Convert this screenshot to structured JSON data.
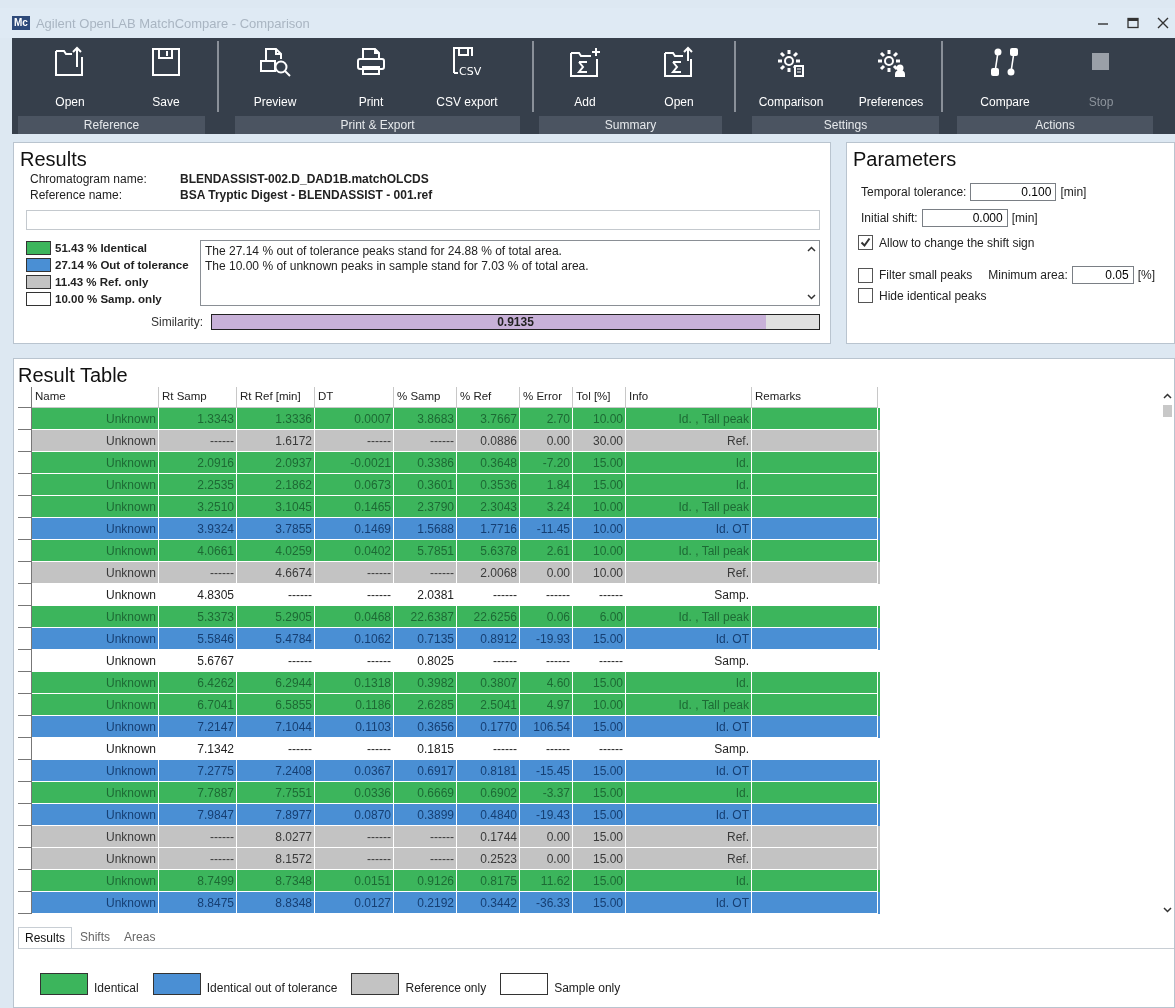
{
  "window": {
    "app_icon": "Mc",
    "title": "Agilent OpenLAB MatchCompare - Comparison"
  },
  "toolbar": {
    "groups": [
      {
        "label": "Reference",
        "buttons": [
          {
            "label": "Open",
            "disabled": false
          },
          {
            "label": "Save",
            "disabled": false
          }
        ]
      },
      {
        "label": "Print & Export",
        "buttons": [
          {
            "label": "Preview",
            "disabled": false
          },
          {
            "label": "Print",
            "disabled": false
          },
          {
            "label": "CSV export",
            "disabled": false,
            "icon_text": "CSV"
          }
        ]
      },
      {
        "label": "Summary",
        "buttons": [
          {
            "label": "Add",
            "disabled": false
          },
          {
            "label": "Open",
            "disabled": false
          }
        ]
      },
      {
        "label": "Settings",
        "buttons": [
          {
            "label": "Comparison",
            "disabled": false
          },
          {
            "label": "Preferences",
            "disabled": false
          }
        ]
      },
      {
        "label": "Actions",
        "buttons": [
          {
            "label": "Compare",
            "disabled": false
          },
          {
            "label": "Stop",
            "disabled": true
          }
        ]
      }
    ]
  },
  "results": {
    "title": "Results",
    "fields": [
      {
        "label": "Chromatogram name:",
        "value": "BLENDASSIST-002.D_DAD1B.matchOLCDS"
      },
      {
        "label": "Reference name:",
        "value": "BSA Tryptic Digest - BLENDASSIST - 001.ref"
      }
    ],
    "summary_legend": [
      {
        "label": "51.43 % Identical",
        "color": "#3cb55c"
      },
      {
        "label": "27.14 % Out of tolerance",
        "color": "#4a8fd4"
      },
      {
        "label": "11.43 % Ref. only",
        "color": "#c3c3c3"
      },
      {
        "label": "10.00 % Samp. only",
        "color": "#ffffff"
      }
    ],
    "messages": [
      "The 27.14 % out of tolerance peaks stand for 24.88 % of total area.",
      "The 10.00 % of unknown peaks in sample stand for 7.03 % of total area."
    ],
    "similarity": {
      "label": "Similarity:",
      "level": 0.9135,
      "reading": "0.9135"
    }
  },
  "parameters": {
    "title": "Parameters",
    "temporal_tolerance": {
      "label": "Temporal tolerance:",
      "value": "0.100",
      "unit": "[min]"
    },
    "initial_shift": {
      "label": "Initial shift:",
      "value": "0.000",
      "unit": "[min]"
    },
    "allow_shift_sign": {
      "label": "Allow to change the shift sign",
      "checked": true
    },
    "filter_small_peaks": {
      "label": "Filter small peaks",
      "checked": false
    },
    "minimum_area": {
      "label": "Minimum area:",
      "value": "0.05",
      "unit": "[%]"
    },
    "hide_identical": {
      "label": "Hide identical peaks",
      "checked": false
    }
  },
  "result_table": {
    "title": "Result Table",
    "columns": [
      "Name",
      "Rt Samp",
      "Rt Ref [min]",
      "DT",
      "% Samp",
      "% Ref",
      "% Error",
      "Tol [%]",
      "Info",
      "Remarks"
    ],
    "rows": [
      {
        "kind": "identical",
        "cells": [
          "Unknown",
          "1.3343",
          "1.3336",
          "0.0007",
          "3.8683",
          "3.7667",
          "2.70",
          "10.00",
          "Id. , Tall peak"
        ]
      },
      {
        "kind": "ref",
        "cells": [
          "Unknown",
          "------",
          "1.6172",
          "------",
          "------",
          "0.0886",
          "0.00",
          "30.00",
          "Ref."
        ]
      },
      {
        "kind": "identical",
        "cells": [
          "Unknown",
          "2.0916",
          "2.0937",
          "-0.0021",
          "0.3386",
          "0.3648",
          "-7.20",
          "15.00",
          "Id."
        ]
      },
      {
        "kind": "identical",
        "cells": [
          "Unknown",
          "2.2535",
          "2.1862",
          "0.0673",
          "0.3601",
          "0.3536",
          "1.84",
          "15.00",
          "Id."
        ]
      },
      {
        "kind": "identical",
        "cells": [
          "Unknown",
          "3.2510",
          "3.1045",
          "0.1465",
          "2.3790",
          "2.3043",
          "3.24",
          "10.00",
          "Id. , Tall peak"
        ]
      },
      {
        "kind": "ot",
        "cells": [
          "Unknown",
          "3.9324",
          "3.7855",
          "0.1469",
          "1.5688",
          "1.7716",
          "-11.45",
          "10.00",
          "Id. OT"
        ]
      },
      {
        "kind": "identical",
        "cells": [
          "Unknown",
          "4.0661",
          "4.0259",
          "0.0402",
          "5.7851",
          "5.6378",
          "2.61",
          "10.00",
          "Id. , Tall peak"
        ]
      },
      {
        "kind": "ref",
        "cells": [
          "Unknown",
          "------",
          "4.6674",
          "------",
          "------",
          "2.0068",
          "0.00",
          "10.00",
          "Ref."
        ]
      },
      {
        "kind": "samp",
        "cells": [
          "Unknown",
          "4.8305",
          "------",
          "------",
          "2.0381",
          "------",
          "------",
          "------",
          "Samp."
        ]
      },
      {
        "kind": "identical",
        "cells": [
          "Unknown",
          "5.3373",
          "5.2905",
          "0.0468",
          "22.6387",
          "22.6256",
          "0.06",
          "6.00",
          "Id. , Tall peak"
        ]
      },
      {
        "kind": "ot",
        "cells": [
          "Unknown",
          "5.5846",
          "5.4784",
          "0.1062",
          "0.7135",
          "0.8912",
          "-19.93",
          "15.00",
          "Id. OT"
        ]
      },
      {
        "kind": "samp",
        "cells": [
          "Unknown",
          "5.6767",
          "------",
          "------",
          "0.8025",
          "------",
          "------",
          "------",
          "Samp."
        ]
      },
      {
        "kind": "identical",
        "cells": [
          "Unknown",
          "6.4262",
          "6.2944",
          "0.1318",
          "0.3982",
          "0.3807",
          "4.60",
          "15.00",
          "Id."
        ]
      },
      {
        "kind": "identical",
        "cells": [
          "Unknown",
          "6.7041",
          "6.5855",
          "0.1186",
          "2.6285",
          "2.5041",
          "4.97",
          "10.00",
          "Id. , Tall peak"
        ]
      },
      {
        "kind": "ot",
        "cells": [
          "Unknown",
          "7.2147",
          "7.1044",
          "0.1103",
          "0.3656",
          "0.1770",
          "106.54",
          "15.00",
          "Id. OT"
        ]
      },
      {
        "kind": "samp",
        "cells": [
          "Unknown",
          "7.1342",
          "------",
          "------",
          "0.1815",
          "------",
          "------",
          "------",
          "Samp."
        ]
      },
      {
        "kind": "ot",
        "cells": [
          "Unknown",
          "7.2775",
          "7.2408",
          "0.0367",
          "0.6917",
          "0.8181",
          "-15.45",
          "15.00",
          "Id. OT"
        ]
      },
      {
        "kind": "identical",
        "cells": [
          "Unknown",
          "7.7887",
          "7.7551",
          "0.0336",
          "0.6669",
          "0.6902",
          "-3.37",
          "15.00",
          "Id."
        ]
      },
      {
        "kind": "ot",
        "cells": [
          "Unknown",
          "7.9847",
          "7.8977",
          "0.0870",
          "0.3899",
          "0.4840",
          "-19.43",
          "15.00",
          "Id. OT"
        ]
      },
      {
        "kind": "ref",
        "cells": [
          "Unknown",
          "------",
          "8.0277",
          "------",
          "------",
          "0.1744",
          "0.00",
          "15.00",
          "Ref."
        ]
      },
      {
        "kind": "ref",
        "cells": [
          "Unknown",
          "------",
          "8.1572",
          "------",
          "------",
          "0.2523",
          "0.00",
          "15.00",
          "Ref."
        ]
      },
      {
        "kind": "identical",
        "cells": [
          "Unknown",
          "8.7499",
          "8.7348",
          "0.0151",
          "0.9126",
          "0.8175",
          "11.62",
          "15.00",
          "Id."
        ]
      },
      {
        "kind": "ot",
        "cells": [
          "Unknown",
          "8.8475",
          "8.8348",
          "0.0127",
          "0.2192",
          "0.3442",
          "-36.33",
          "15.00",
          "Id. OT"
        ]
      }
    ]
  },
  "tabs": [
    {
      "label": "Results",
      "selected": true
    },
    {
      "label": "Shifts",
      "selected": false
    },
    {
      "label": "Areas",
      "selected": false
    }
  ],
  "legend": [
    {
      "label": "Identical",
      "color": "#3cb55c"
    },
    {
      "label": "Identical out of tolerance",
      "color": "#4a8fd4"
    },
    {
      "label": "Reference only",
      "color": "#c3c3c3"
    },
    {
      "label": "Sample only",
      "color": "#ffffff"
    }
  ]
}
